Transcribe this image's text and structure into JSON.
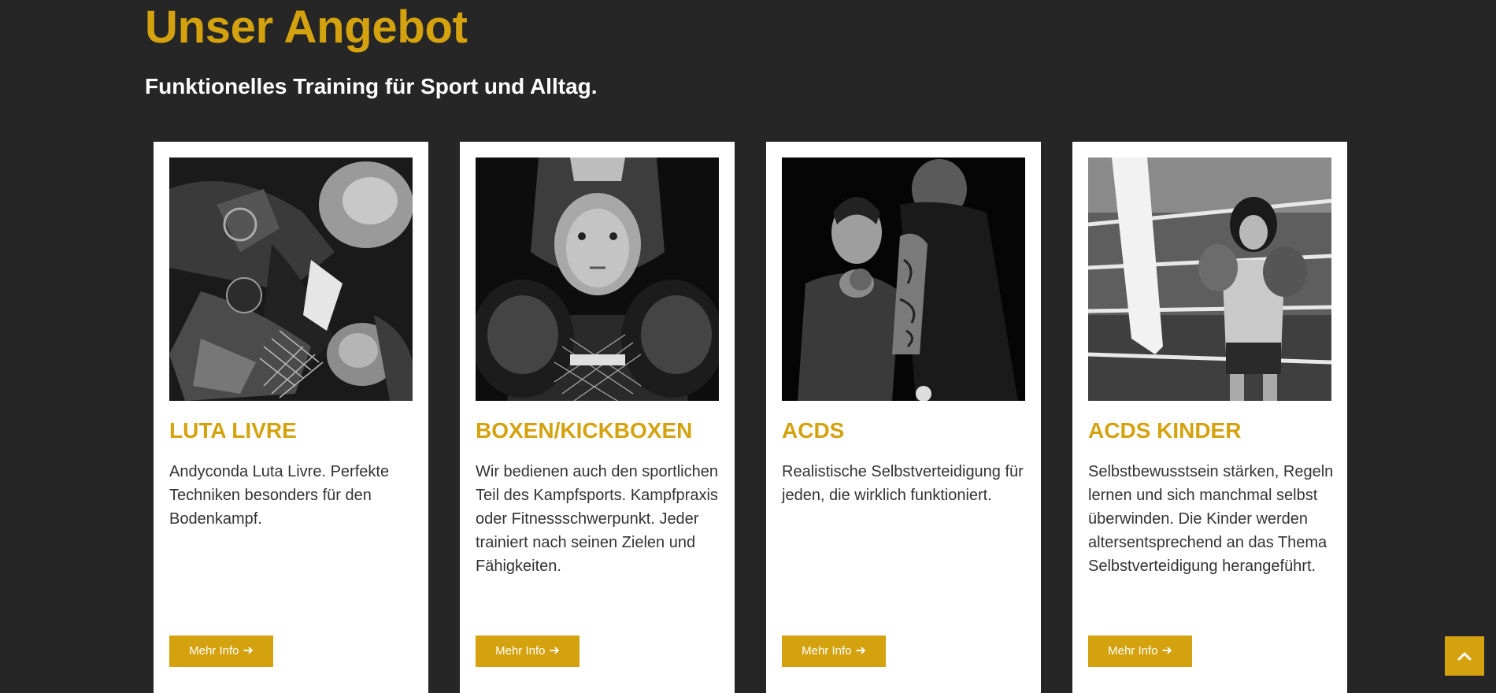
{
  "section": {
    "title": "Unser Angebot",
    "subtitle": "Funktionelles Training für Sport und Alltag."
  },
  "cards": [
    {
      "title": "LUTA LIVRE",
      "text": "Andyconda Luta Livre. Perfekte Techniken besonders für den Bodenkampf.",
      "button_label": "Mehr Info",
      "image": "grappling-photo"
    },
    {
      "title": "BOXEN/KICKBOXEN",
      "text": "Wir bedienen auch den sportlichen Teil des Kampfsports. Kampfpraxis oder Fitnessschwerpunkt. Jeder trainiert nach seinen Zielen und Fähigkeiten.",
      "button_label": "Mehr Info",
      "image": "boxer-photo"
    },
    {
      "title": "ACDS",
      "text": "Realistische Selbstverteidigung für jeden, die wirklich funktioniert.",
      "button_label": "Mehr Info",
      "image": "self-defense-photo"
    },
    {
      "title": "ACDS KINDER",
      "text": "Selbstbewusstsein stärken, Regeln lernen und sich manchmal selbst überwinden. Die Kinder werden altersentsprechend an das Thema Selbstverteidigung herangeführt.",
      "button_label": "Mehr Info",
      "image": "kids-boxing-photo"
    }
  ],
  "scroll_top_icon": "chevron-up-icon",
  "colors": {
    "accent": "#d4a20e",
    "background": "#262626",
    "card": "#ffffff",
    "text": "#333333"
  }
}
